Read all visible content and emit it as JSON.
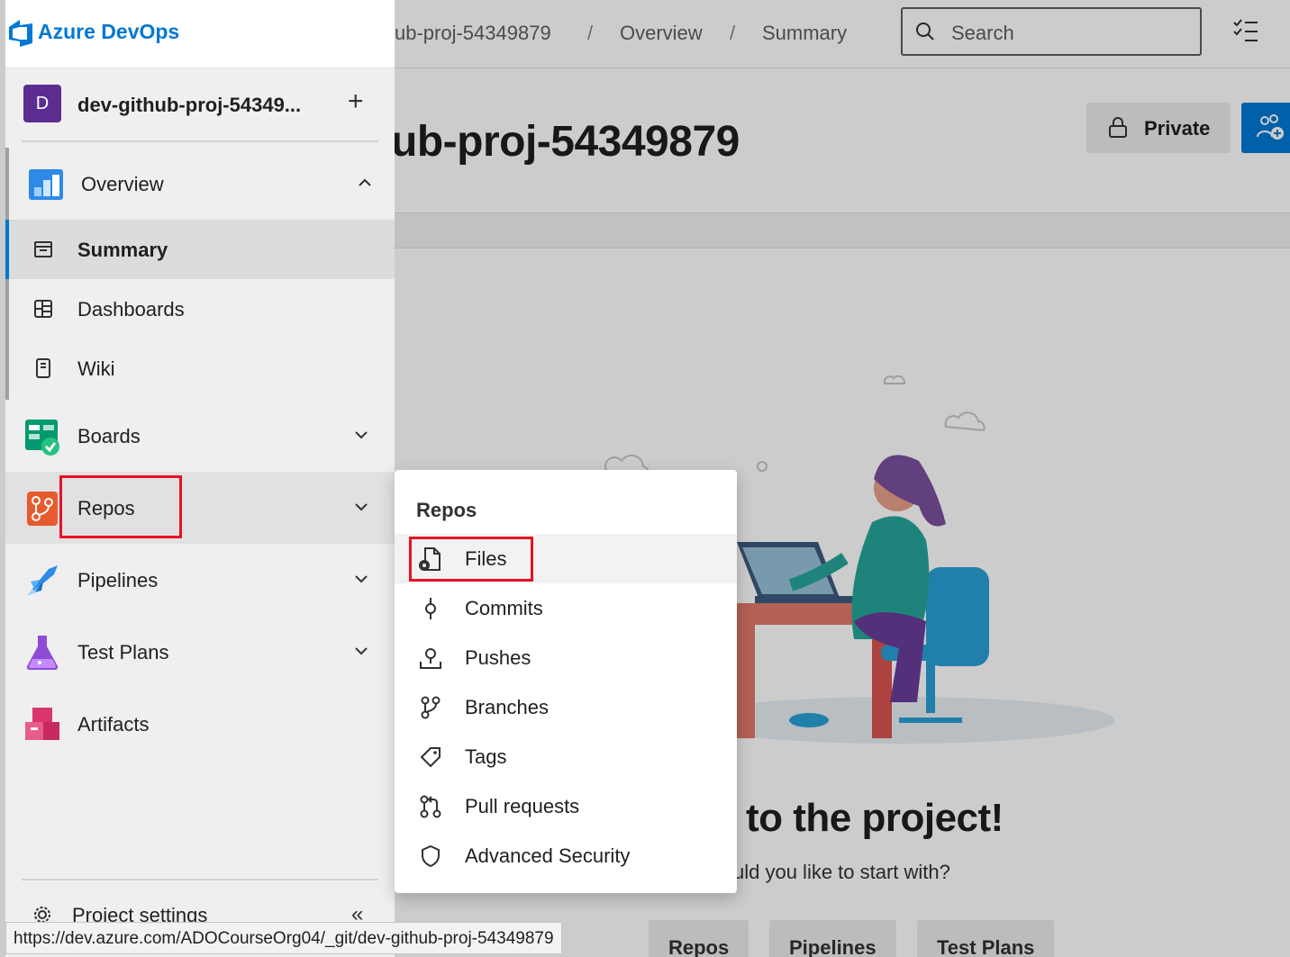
{
  "app": {
    "brand": "Azure DevOps"
  },
  "header": {
    "breadcrumbs": [
      "ub-proj-54349879",
      "Overview",
      "Summary"
    ],
    "search_placeholder": "Search"
  },
  "project": {
    "avatar_letter": "D",
    "name_truncated": "dev-github-proj-54349...",
    "title_partial": "ub-proj-54349879",
    "visibility": "Private"
  },
  "nav": {
    "overview": {
      "label": "Overview",
      "children": [
        "Summary",
        "Dashboards",
        "Wiki"
      ]
    },
    "boards": "Boards",
    "repos": "Repos",
    "pipelines": "Pipelines",
    "test_plans": "Test Plans",
    "artifacts": "Artifacts",
    "project_settings": "Project settings"
  },
  "flyout": {
    "title": "Repos",
    "items": [
      "Files",
      "Commits",
      "Pushes",
      "Branches",
      "Tags",
      "Pull requests",
      "Advanced Security"
    ]
  },
  "welcome": {
    "heading_partial": "to the project!",
    "question_partial": "uld you like to start with?",
    "start_buttons": [
      "Repos",
      "Pipelines",
      "Test Plans"
    ]
  },
  "status_url": "https://dev.azure.com/ADOCourseOrg04/_git/dev-github-proj-54349879",
  "colors": {
    "accent": "#0078d4",
    "highlight_box": "#e81123",
    "nav_bg": "#efefef"
  }
}
